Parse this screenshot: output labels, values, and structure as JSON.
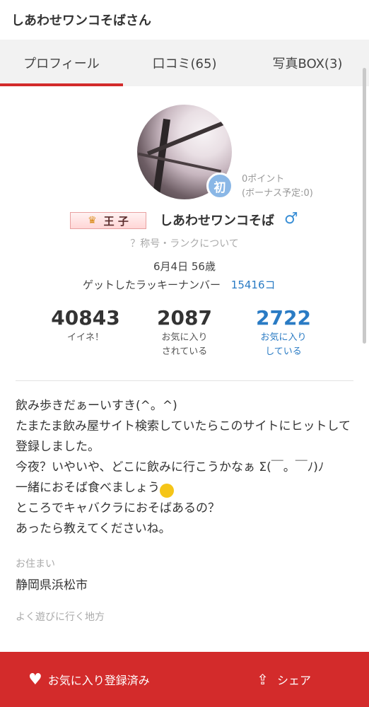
{
  "header": {
    "title": "しあわせワンコそばさん"
  },
  "tabs": [
    {
      "label": "プロフィール",
      "active": true
    },
    {
      "label": "口コミ(65)",
      "active": false
    },
    {
      "label": "写真BOX(3)",
      "active": false
    }
  ],
  "profile": {
    "rank_badge": "初",
    "points": "0ポイント",
    "bonus": "(ボーナス予定:0)",
    "title_crown": "♛",
    "title_text": "王 子",
    "nickname": "しあわせワンコそば",
    "gender_symbol": "♂",
    "rank_help": "？称号・ランクについて",
    "birthday": "6月4日 56歳",
    "lucky_label": "ゲットしたラッキーナンバー",
    "lucky_number": "15416コ"
  },
  "stats": [
    {
      "value": "40843",
      "label": "イイネ！"
    },
    {
      "value": "2087",
      "label": "お気に入り\nされている"
    },
    {
      "value": "2722",
      "label": "お気に入り\nしている"
    }
  ],
  "bio": {
    "line1": "飲み歩きだぁーいすき(^。^)",
    "line2": "たまたま飲み屋サイト検索していたらこのサイトにヒットして登録しました。",
    "line3": "今夜？いやいや、どこに飲みに行こうかなぁ Σ(￣。￣ﾉ)ﾉ",
    "line4": "一緒におそば食べましょう",
    "line5": "ところでキャバクラにおそばあるの？",
    "line6": "あったら教えてくださいね。"
  },
  "residence": {
    "label": "お住まい",
    "value": "静岡県浜松市"
  },
  "frequent_area": {
    "label": "よく遊びに行く地方"
  },
  "bottom_bar": {
    "favorite_label": "お気に入り登録済み",
    "share_label": "シェア"
  },
  "colors": {
    "accent": "#d32b2b",
    "link_blue": "#2a7bc4",
    "badge_blue": "#8ab7e6",
    "gender_blue": "#3a8fd6"
  }
}
